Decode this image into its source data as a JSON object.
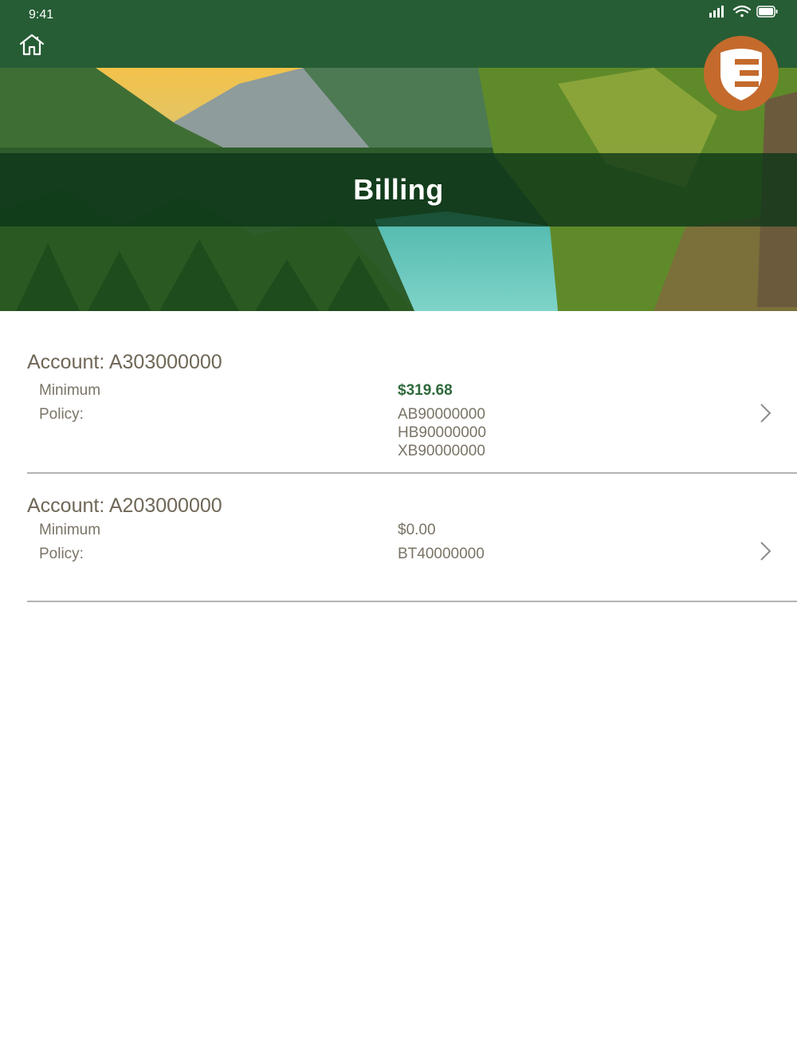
{
  "status_bar": {
    "time": "9:41",
    "icons": [
      "signal-icon",
      "wifi-icon",
      "battery-icon"
    ]
  },
  "header": {
    "home_icon": "home-icon",
    "title": "Billing",
    "badge_icon": "shield-logo-icon"
  },
  "colors": {
    "header_bg": "#265d35",
    "accent_green": "#2f6a3c",
    "badge": "#c46a2c",
    "text": "#7a7466"
  },
  "accounts": [
    {
      "title": "Account: A303000000",
      "minimum_label": "Minimum",
      "minimum_value": "$319.68",
      "policy_label": "Policy:",
      "policies": [
        "AB90000000",
        "HB90000000",
        "XB90000000"
      ]
    },
    {
      "title": "Account: A203000000",
      "minimum_label": "Minimum",
      "minimum_value": "$0.00",
      "policy_label": "Policy:",
      "policies": [
        "BT40000000"
      ]
    }
  ]
}
